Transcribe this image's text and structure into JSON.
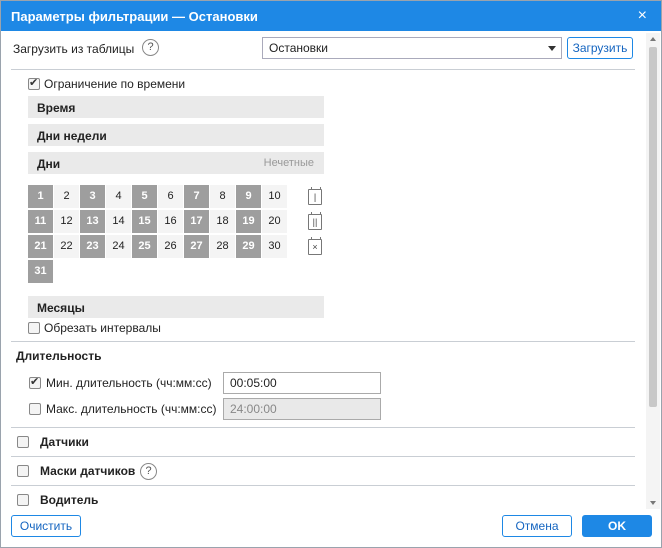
{
  "window": {
    "title": "Параметры фильтрации — Остановки",
    "close_glyph": "×"
  },
  "load": {
    "label": "Загрузить из таблицы",
    "help": "?",
    "selected": "Остановки",
    "button": "Загрузить"
  },
  "time_limit": {
    "label": "Ограничение по времени",
    "checked": true
  },
  "sections": {
    "time": "Время",
    "weekdays": "Дни недели",
    "days": "Дни",
    "days_mode": "Нечетные",
    "months": "Месяцы"
  },
  "days": [
    "1",
    "2",
    "3",
    "4",
    "5",
    "6",
    "7",
    "8",
    "9",
    "10",
    "11",
    "12",
    "13",
    "14",
    "15",
    "16",
    "17",
    "18",
    "19",
    "20",
    "21",
    "22",
    "23",
    "24",
    "25",
    "26",
    "27",
    "28",
    "29",
    "30",
    "31"
  ],
  "calendar_icons": [
    {
      "name": "calendar-odd-icon",
      "glyph": "|"
    },
    {
      "name": "calendar-even-icon",
      "glyph": "||"
    },
    {
      "name": "calendar-clear-icon",
      "glyph": "×"
    }
  ],
  "trim": {
    "label": "Обрезать интервалы",
    "checked": false
  },
  "duration": {
    "title": "Длительность",
    "min_label": "Мин. длительность (чч:мм:сс)",
    "min_checked": true,
    "min_value": "00:05:00",
    "max_label": "Макс. длительность (чч:мм:сс)",
    "max_checked": false,
    "max_value": "24:00:00"
  },
  "groups": {
    "sensors": "Датчики",
    "sensor_masks": "Маски датчиков",
    "sensor_masks_help": "?",
    "driver": "Водитель"
  },
  "footer": {
    "clear": "Очистить",
    "cancel": "Отмена",
    "ok": "OK"
  },
  "colors": {
    "accent": "#1e88e5",
    "odd_day": "#9e9e9e",
    "even_day": "#f4f4f4"
  }
}
